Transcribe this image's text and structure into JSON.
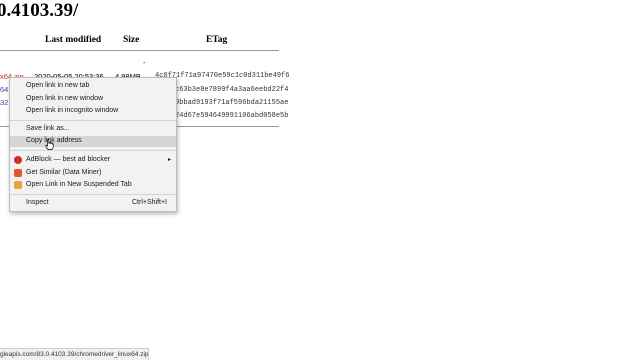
{
  "page": {
    "heading": "0.4103.39/",
    "columns": {
      "last_modified": "Last modified",
      "size": "Size",
      "etag": "ETag"
    },
    "parent_row": {
      "size": "-"
    },
    "rows": [
      {
        "name": "x64.zip",
        "modified": "2020-05-05 20:53:36",
        "size": "4.98MB",
        "etag": "4c0f71f71a97470e59c1c0d311be49f6"
      },
      {
        "name": "64",
        "etag": "c63b3e8e7899f4a3aa6eebd22f4"
      },
      {
        "name": "32",
        "etag": "0bbad9193f71af596bda21155ae"
      },
      {
        "name": "",
        "etag": "24d67e594649991106abd058e5b"
      }
    ]
  },
  "context_menu": {
    "items": [
      {
        "label": "Open link in new tab"
      },
      {
        "label": "Open link in new window"
      },
      {
        "label": "Open link in incognito window"
      },
      {
        "label": "Save link as..."
      },
      {
        "label": "Copy link address"
      },
      {
        "label": "AdBlock — best ad blocker",
        "icon": "adblock-icon",
        "submenu_arrow": "▸"
      },
      {
        "label": "Get Similar (Data Miner)",
        "icon": "data-miner-icon"
      },
      {
        "label": "Open Link in New Suspended Tab",
        "icon": "suspender-icon"
      },
      {
        "label": "Inspect",
        "shortcut": "Ctrl+Shift+I"
      }
    ]
  },
  "status_bar": {
    "url": "gleapis.com/83.0.4103.39/chromedriver_linux64.zip"
  },
  "colors": {
    "adblock": "#d22d2d",
    "data_miner": "#e4572e",
    "suspender": "#e9a23b",
    "highlight": "#d6d6d6"
  }
}
